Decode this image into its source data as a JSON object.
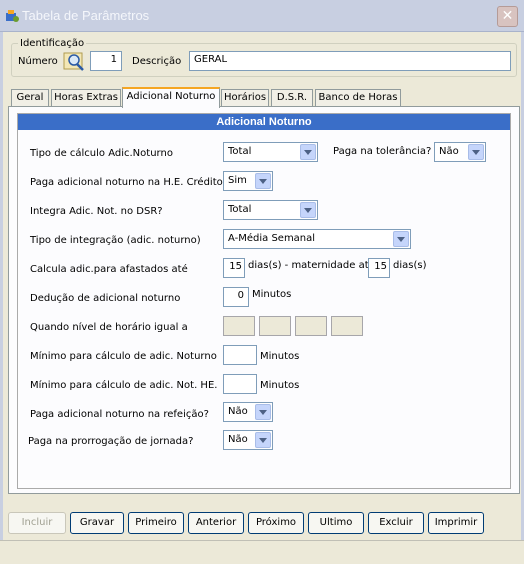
{
  "window": {
    "title": "Tabela de Parâmetros",
    "close_label": "✕"
  },
  "identificacao": {
    "legend": "Identificação",
    "numero_label": "Número",
    "numero_value": "1",
    "descricao_label": "Descrição",
    "descricao_value": "GERAL"
  },
  "tabs": [
    {
      "label": "Geral"
    },
    {
      "label": "Horas Extras"
    },
    {
      "label": "Adicional Noturno"
    },
    {
      "label": "Horários"
    },
    {
      "label": "D.S.R."
    },
    {
      "label": "Banco de Horas"
    }
  ],
  "panel": {
    "header": "Adicional Noturno",
    "tipo_calculo": {
      "label": "Tipo de cálculo Adic.Noturno",
      "value": "Total"
    },
    "paga_tolerancia": {
      "label": "Paga na tolerância?",
      "value": "Não"
    },
    "paga_he_credito": {
      "label": "Paga adicional noturno na H.E. Crédito?",
      "value": "Sim"
    },
    "integra_dsr": {
      "label": "Integra Adic. Not. no DSR?",
      "value": "Total"
    },
    "tipo_integracao": {
      "label": "Tipo de integração (adic. noturno)",
      "value": "A-Média Semanal"
    },
    "afastados": {
      "label": "Calcula adic.para afastados até",
      "dias_value": "15",
      "mid_label": "dias(s) - maternidade até",
      "maternidade_value": "15",
      "end_label": "dias(s)"
    },
    "deducao": {
      "label": "Dedução de adicional noturno",
      "value": "0",
      "unit": "Minutos"
    },
    "nivel_horario": {
      "label": "Quando nível de horário igual a"
    },
    "minimo_noturno": {
      "label": "Mínimo para cálculo de adic. Noturno",
      "value": "",
      "unit": "Minutos"
    },
    "minimo_he": {
      "label": "Mínimo para cálculo de adic. Not. HE.",
      "value": "",
      "unit": "Minutos"
    },
    "paga_refeicao": {
      "label": "Paga adicional noturno na refeição?",
      "value": "Não"
    },
    "paga_prorrogacao": {
      "label": "Paga na prorrogação de jornada?",
      "value": "Não"
    }
  },
  "buttons": {
    "incluir": "Incluir",
    "gravar": "Gravar",
    "primeiro": "Primeiro",
    "anterior": "Anterior",
    "proximo": "Próximo",
    "ultimo": "Ultimo",
    "excluir": "Excluir",
    "imprimir": "Imprimir"
  }
}
